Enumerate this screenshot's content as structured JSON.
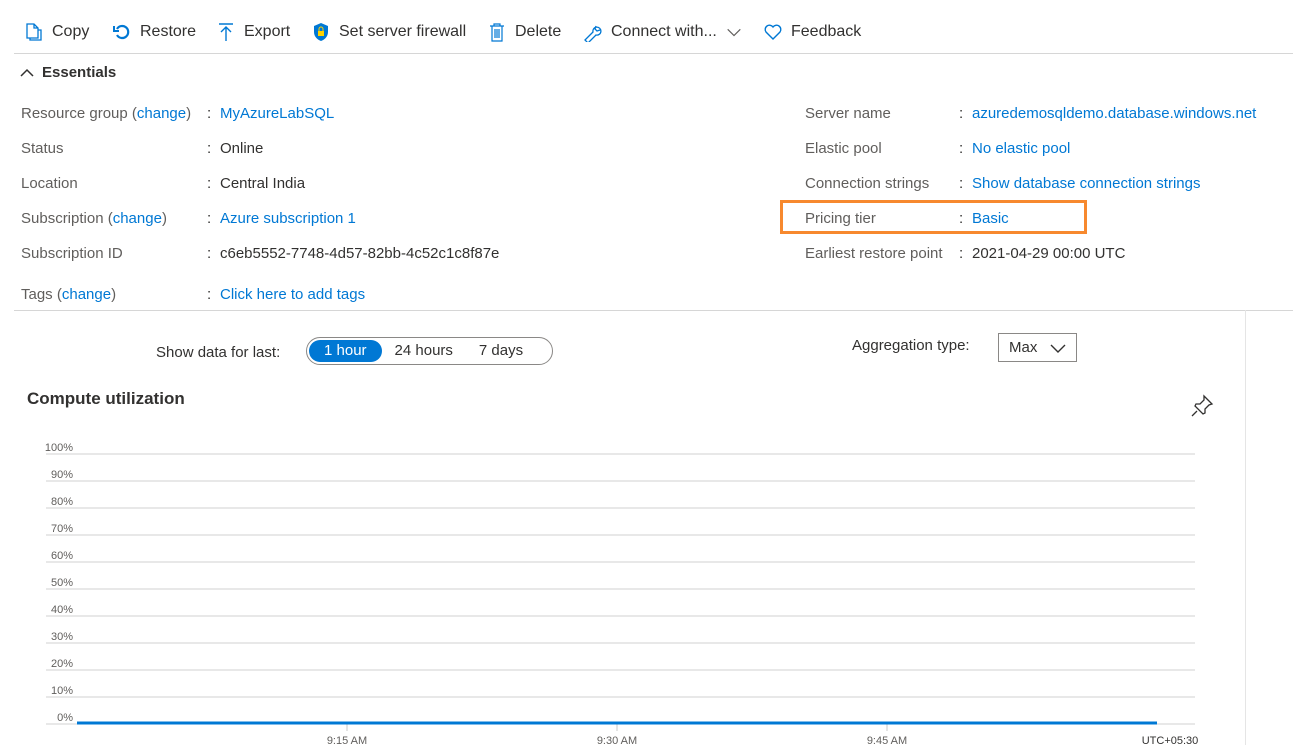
{
  "toolbar": {
    "copy": "Copy",
    "restore": "Restore",
    "export": "Export",
    "firewall": "Set server firewall",
    "delete": "Delete",
    "connect": "Connect with...",
    "feedback": "Feedback"
  },
  "essentials": {
    "title": "Essentials",
    "resource_group_label": "Resource group",
    "change": "change",
    "resource_group": "MyAzureLabSQL",
    "status_label": "Status",
    "status": "Online",
    "location_label": "Location",
    "location": "Central India",
    "subscription_label": "Subscription",
    "subscription": "Azure subscription 1",
    "subscription_id_label": "Subscription ID",
    "subscription_id": "c6eb5552-7748-4d57-82bb-4c52c1c8f87e",
    "tags_label": "Tags",
    "tags": "Click here to add tags",
    "server_name_label": "Server name",
    "server_name": "azuredemosqldemo.database.windows.net",
    "elastic_pool_label": "Elastic pool",
    "elastic_pool": "No elastic pool",
    "conn_label": "Connection strings",
    "conn": "Show database connection strings",
    "pricing_label": "Pricing tier",
    "pricing": "Basic",
    "restore_label": "Earliest restore point",
    "restore": "2021-04-29 00:00 UTC",
    "colon": ":"
  },
  "filters": {
    "show_label": "Show data for last:",
    "ranges": [
      "1 hour",
      "24 hours",
      "7 days"
    ],
    "agg_label": "Aggregation type:",
    "agg_value": "Max"
  },
  "highlight_color": "#f7892e",
  "chart_data": {
    "type": "line",
    "title": "Compute utilization",
    "ylim": [
      0,
      100
    ],
    "y_ticks": [
      "100%",
      "90%",
      "80%",
      "70%",
      "60%",
      "50%",
      "40%",
      "30%",
      "20%",
      "10%",
      "0%"
    ],
    "x_ticks": [
      "9:15 AM",
      "9:30 AM",
      "9:45 AM"
    ],
    "x_tick_minutes": [
      15,
      30,
      45
    ],
    "timezone": "UTC+05:30",
    "x_range_minutes": [
      0,
      60
    ],
    "series": [
      {
        "name": "Compute utilization",
        "color": "#0078d4",
        "x": [
          0,
          60
        ],
        "y": [
          0,
          0
        ]
      }
    ]
  }
}
